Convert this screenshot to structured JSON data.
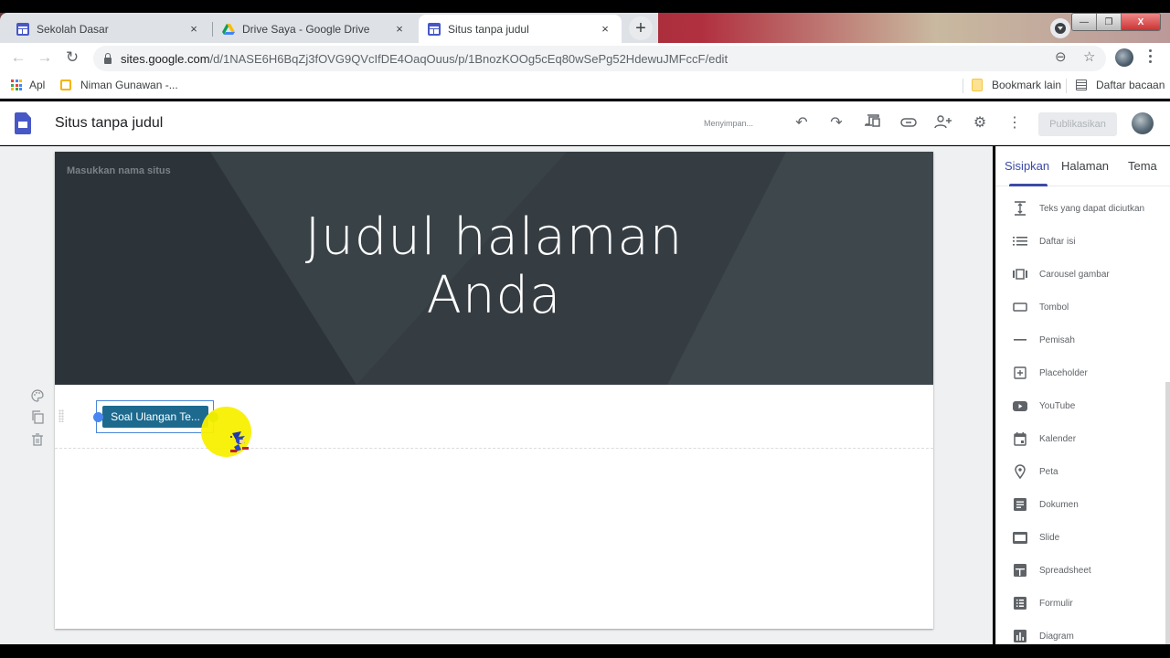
{
  "browser": {
    "tabs": [
      {
        "title": "Sekolah Dasar",
        "icon": "google-sites-icon",
        "active": false
      },
      {
        "title": "Drive Saya - Google Drive",
        "icon": "google-drive-icon",
        "active": false
      },
      {
        "title": "Situs tanpa judul",
        "icon": "google-sites-icon",
        "active": true
      }
    ],
    "new_tab_label": "+",
    "close_label": "×",
    "url_host": "sites.google.com",
    "url_path": "/d/1NASE6H6BqZj3fOVG9QVcIfDE4OaqOuus/p/1BnozKOOg5cEq80wSePg52HdewuJMFccF/edit",
    "bookmarks": [
      {
        "label": "Apl",
        "icon": "apps-grid-icon"
      },
      {
        "label": "Niman Gunawan -...",
        "icon": "folder-icon"
      }
    ],
    "bookmarks_right": [
      {
        "label": "Bookmark lain",
        "icon": "folder-icon"
      },
      {
        "label": "Daftar bacaan",
        "icon": "reading-list-icon"
      }
    ]
  },
  "sites": {
    "title": "Situs tanpa judul",
    "save_status": "Menyimpan...",
    "publish_label": "Publikasikan",
    "toolbar_icons": [
      "undo-icon",
      "redo-icon",
      "preview-icon",
      "link-icon",
      "share-icon",
      "settings-icon",
      "more-icon"
    ]
  },
  "page": {
    "site_name_placeholder": "Masukkan nama situs",
    "title_line1": "Judul halaman",
    "title_line2": "Anda",
    "button_label": "Soal Ulangan Te...",
    "colors": {
      "banner": "#353d43",
      "button": "#1d6a8e",
      "selection": "#4a86d8",
      "accent": "#3c4aa5"
    }
  },
  "panel": {
    "tabs": [
      {
        "label": "Sisipkan",
        "active": true
      },
      {
        "label": "Halaman",
        "active": false
      },
      {
        "label": "Tema",
        "active": false
      }
    ],
    "items": [
      {
        "label": "Teks yang dapat diciutkan",
        "icon": "collapsible-text-icon"
      },
      {
        "label": "Daftar isi",
        "icon": "table-of-contents-icon"
      },
      {
        "label": "Carousel gambar",
        "icon": "image-carousel-icon"
      },
      {
        "label": "Tombol",
        "icon": "button-icon"
      },
      {
        "label": "Pemisah",
        "icon": "divider-icon"
      },
      {
        "label": "Placeholder",
        "icon": "placeholder-icon"
      },
      {
        "label": "YouTube",
        "icon": "youtube-icon"
      },
      {
        "label": "Kalender",
        "icon": "calendar-icon"
      },
      {
        "label": "Peta",
        "icon": "map-pin-icon"
      },
      {
        "label": "Dokumen",
        "icon": "docs-icon"
      },
      {
        "label": "Slide",
        "icon": "slides-icon"
      },
      {
        "label": "Spreadsheet",
        "icon": "sheets-icon"
      },
      {
        "label": "Formulir",
        "icon": "forms-icon"
      },
      {
        "label": "Diagram",
        "icon": "chart-icon"
      }
    ]
  }
}
